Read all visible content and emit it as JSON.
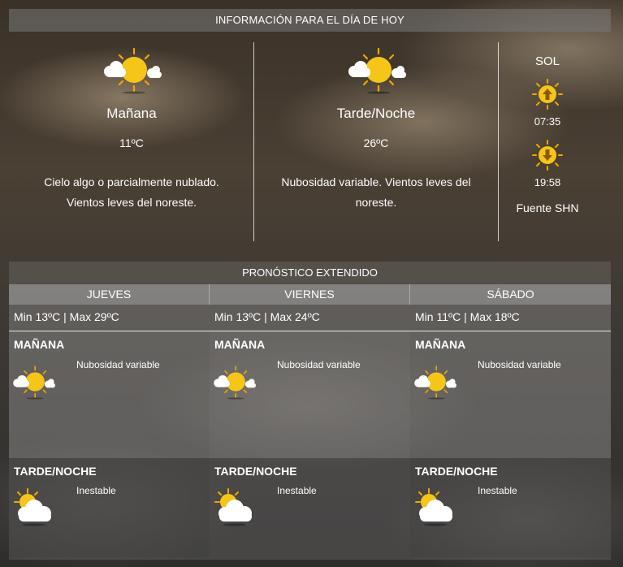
{
  "today": {
    "header": "INFORMACIÓN PARA EL DÍA DE HOY",
    "morning": {
      "title": "Mañana",
      "temp": "11ºC",
      "description": "Cielo algo o parcialmente nublado. Vientos leves del noreste.",
      "icon": "sun-cloud-icon"
    },
    "night": {
      "title": "Tarde/Noche",
      "temp": "26ºC",
      "description": "Nubosidad variable. Vientos leves del noreste.",
      "icon": "sun-cloud-icon"
    },
    "sun": {
      "title": "SOL",
      "sunrise": "07:35",
      "sunset": "19:58",
      "source": "Fuente SHN"
    }
  },
  "extended": {
    "header": "PRONÓSTICO EXTENDIDO",
    "days": [
      {
        "name": "JUEVES",
        "minmax": "Min 13ºC | Max 29ºC",
        "morning": {
          "label": "MAÑANA",
          "desc": "Nubosidad variable",
          "icon": "sun-cloud-icon"
        },
        "night": {
          "label": "TARDE/NOCHE",
          "desc": "Inestable",
          "icon": "cloud-sun-icon"
        }
      },
      {
        "name": "VIERNES",
        "minmax": "Min 13ºC | Max 24ºC",
        "morning": {
          "label": "MAÑANA",
          "desc": "Nubosidad variable",
          "icon": "sun-cloud-icon"
        },
        "night": {
          "label": "TARDE/NOCHE",
          "desc": "Inestable",
          "icon": "cloud-sun-icon"
        }
      },
      {
        "name": "SÁBADO",
        "minmax": "Min 11ºC | Max 18ºC",
        "morning": {
          "label": "MAÑANA",
          "desc": "Nubosidad variable",
          "icon": "sun-cloud-icon"
        },
        "night": {
          "label": "TARDE/NOCHE",
          "desc": "Inestable",
          "icon": "cloud-sun-icon"
        }
      }
    ]
  },
  "colors": {
    "sun": "#f5c518",
    "sun_ray": "#f0a800",
    "cloud": "#ffffff"
  }
}
